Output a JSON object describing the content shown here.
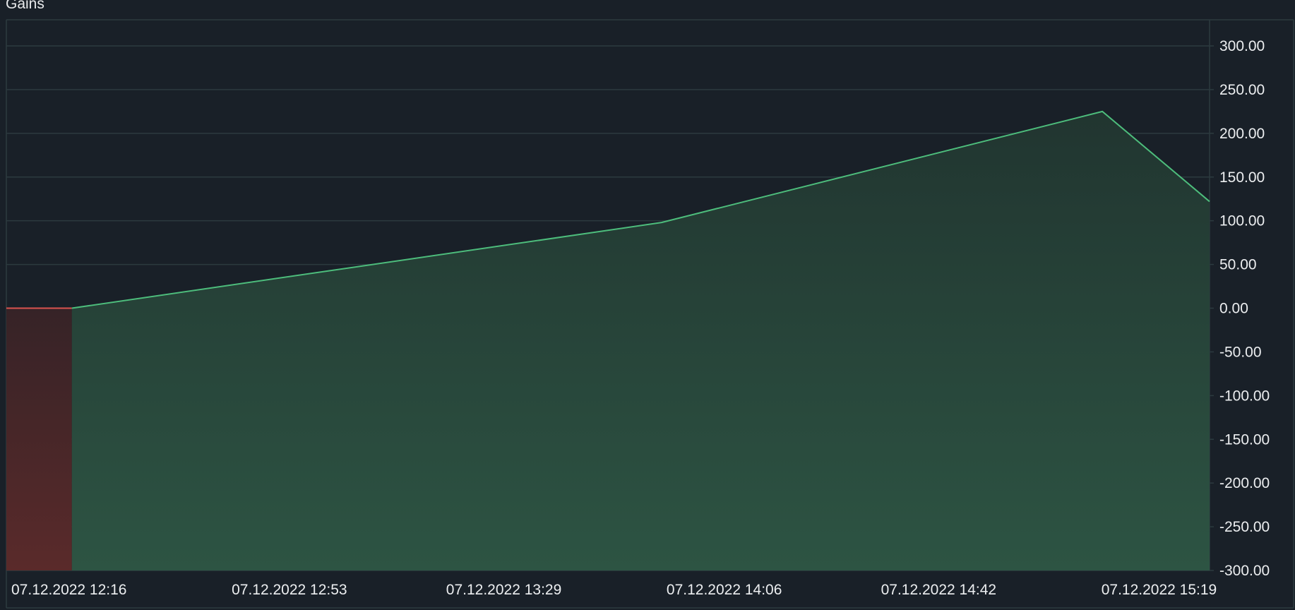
{
  "chart_data": {
    "type": "area",
    "title": "Gains",
    "x_labels": [
      "07.12.2022 12:16",
      "07.12.2022 12:53",
      "07.12.2022 13:29",
      "07.12.2022 14:06",
      "07.12.2022 14:42",
      "07.12.2022 15:19"
    ],
    "x_range": [
      "07.12.2022 12:16",
      "07.12.2022 15:38"
    ],
    "ylim": [
      -300,
      300
    ],
    "y_ticks": [
      "300.00",
      "250.00",
      "200.00",
      "150.00",
      "100.00",
      "50.00",
      "0.00",
      "-50.00",
      "-100.00",
      "-150.00",
      "-200.00",
      "-250.00",
      "-300.00"
    ],
    "y_axis_position": "right",
    "grid": true,
    "series": [
      {
        "points": [
          {
            "x": "07.12.2022 12:16",
            "y": 0
          },
          {
            "x": "07.12.2022 12:27",
            "y": 0
          },
          {
            "x": "07.12.2022 14:06",
            "y": 98
          },
          {
            "x": "07.12.2022 15:20",
            "y": 225
          },
          {
            "x": "07.12.2022 15:38",
            "y": 122
          }
        ]
      }
    ],
    "colors": {
      "background": "#192028",
      "grid": "#2c3a3f",
      "positive_line": "#4dbd7c",
      "positive_fill_top": "#213530",
      "positive_fill_bottom": "#2d5443",
      "negative_line": "#d9534f",
      "negative_fill_top": "#362327",
      "negative_fill_bottom": "#5a2a2a",
      "text": "#eceef0"
    }
  }
}
